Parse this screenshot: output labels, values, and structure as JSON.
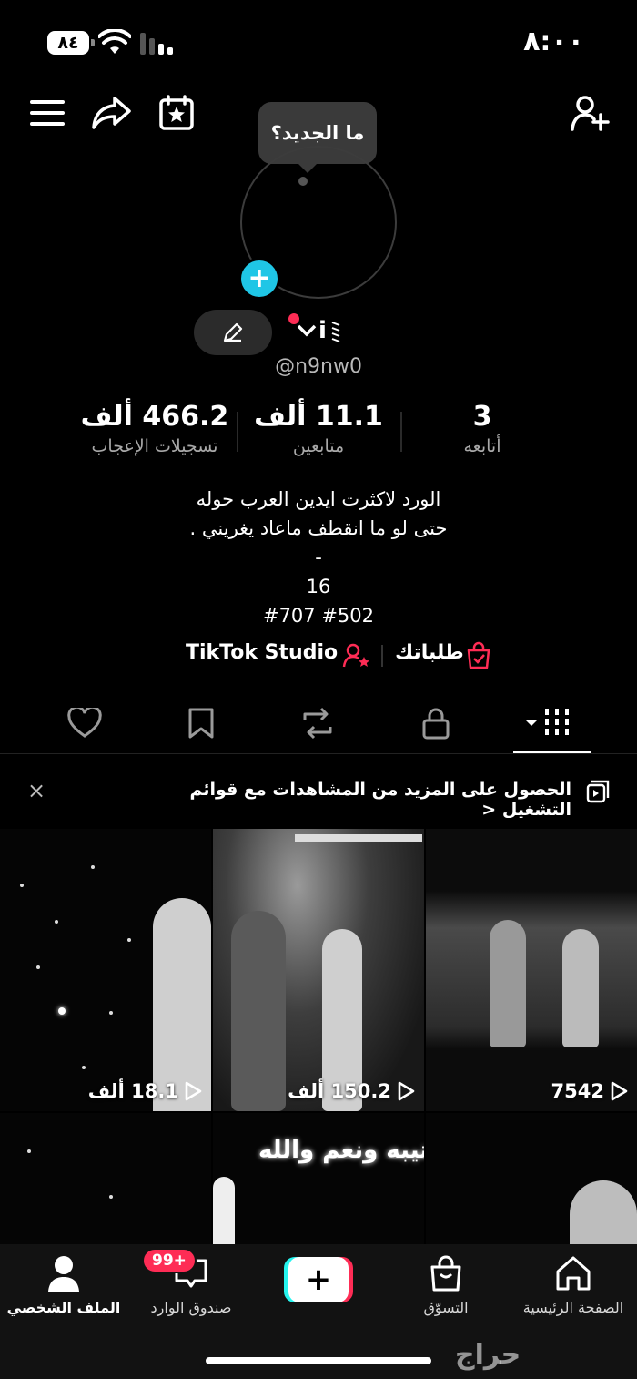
{
  "status_bar": {
    "time": "٨:٠٠",
    "battery": "٨٤"
  },
  "top_bar": {
    "tooltip": "ما الجديد؟"
  },
  "profile": {
    "display_name": "i",
    "username": "@n9nw0",
    "stats": {
      "likes": {
        "value": "466.2 ألف",
        "label": "تسجيلات الإعجاب"
      },
      "followers": {
        "value": "11.1 ألف",
        "label": "متابعين"
      },
      "following": {
        "value": "3",
        "label": "أتابعه"
      }
    },
    "bio_lines": [
      "الورد لاكثرت ايدين العرب حوله",
      "حتى لو ما انقطف ماعاد يغريني .",
      "-",
      "16",
      "#707 #502"
    ],
    "links": {
      "studio": "TikTok Studio",
      "orders": "طلباتك"
    }
  },
  "tabs": [
    "videos-grid",
    "private",
    "reposts",
    "favorites",
    "liked"
  ],
  "playlist_banner": {
    "text": "الحصول على المزيد من المشاهدات مع قوائم التشغيل <",
    "close": "×"
  },
  "videos": [
    {
      "views": "18.1 ألف"
    },
    {
      "views": "150.2 ألف"
    },
    {
      "views": "7542"
    },
    {
      "caption": "عتيبه ونعم والله"
    }
  ],
  "bottom_nav": {
    "home": "الصفحة الرئيسية",
    "shop": "التسوّق",
    "create": "+",
    "inbox": "صندوق الوارد",
    "inbox_badge": "99+",
    "profile": "الملف الشخصي"
  },
  "watermark": "حراج",
  "colors": {
    "accent_red": "#fe2c55",
    "accent_cyan": "#1fc6e6",
    "background": "#000000"
  }
}
